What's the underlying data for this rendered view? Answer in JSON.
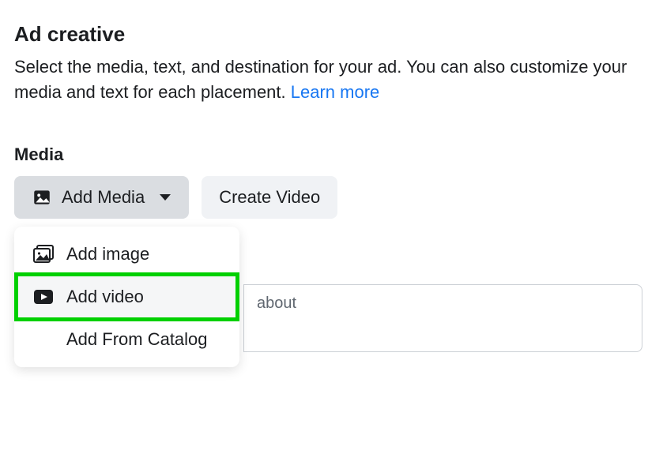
{
  "header": {
    "title": "Ad creative",
    "description_prefix": "Select the media, text, and destination for your ad. You can also customize your media and text for each placement. ",
    "learn_more_label": "Learn more"
  },
  "media": {
    "label": "Media",
    "add_media_button": "Add Media",
    "create_video_button": "Create Video",
    "dropdown": {
      "add_image": "Add image",
      "add_video": "Add video",
      "add_from_catalog": "Add From Catalog"
    }
  },
  "text_preview": {
    "fragment": " about"
  }
}
